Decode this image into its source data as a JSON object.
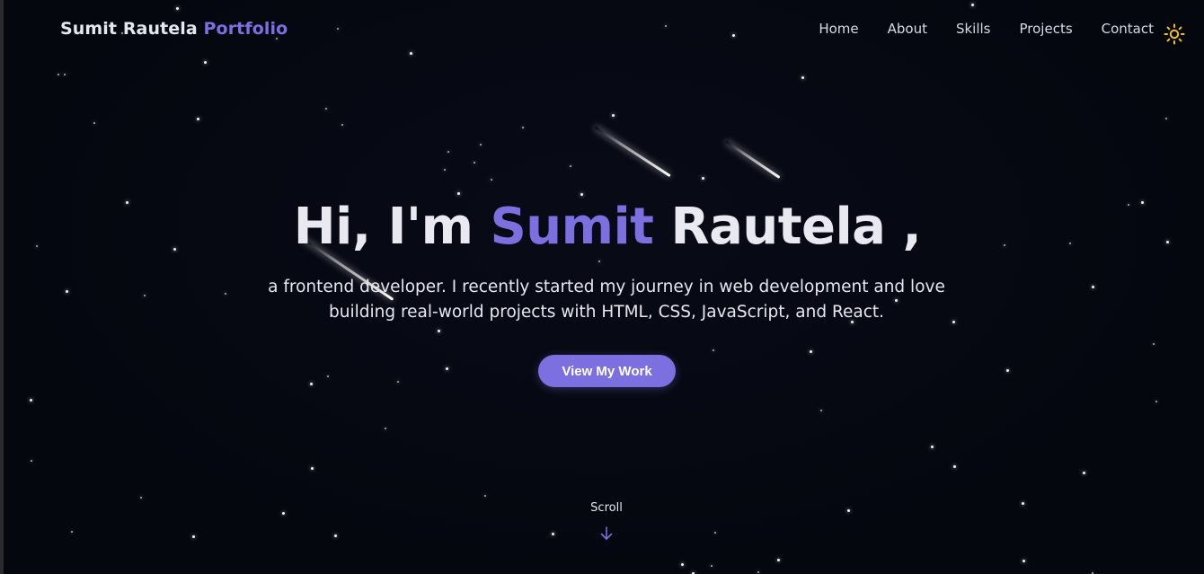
{
  "nav": {
    "brand_primary": "Sumit Rautela",
    "brand_accent": "Portfolio",
    "links": [
      "Home",
      "About",
      "Skills",
      "Projects",
      "Contact"
    ],
    "theme_toggle_icon": "sun-icon"
  },
  "hero": {
    "greeting": "Hi, I'm",
    "first_name": "Sumit",
    "last_name": "Rautela ,",
    "subtitle": "a frontend developer. I recently started my journey in web development and love building real-world projects with HTML, CSS, JavaScript, and React.",
    "cta_label": "View My Work"
  },
  "scroll": {
    "label": "Scroll",
    "icon": "arrow-down-icon"
  },
  "colors": {
    "background": "#05070f",
    "accent": "#7c6fe0",
    "text": "#e8e9f1",
    "sun": "#f5c518"
  }
}
